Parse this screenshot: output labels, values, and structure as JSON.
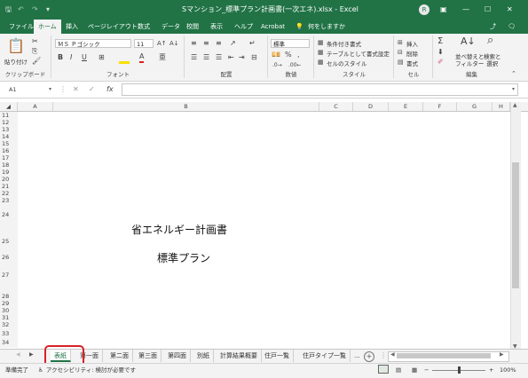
{
  "window": {
    "title": "Sマンション_標準プラン計画書(一次エネ).xlsx - Excel",
    "user_initials": "R",
    "controls": [
      "ribbon-display",
      "minimize",
      "maximize",
      "close"
    ]
  },
  "quick_access": [
    "save",
    "undo",
    "redo",
    "customize"
  ],
  "menu": {
    "tabs": [
      "ファイル",
      "ホーム",
      "挿入",
      "ページレイアウト",
      "数式",
      "データ",
      "校閲",
      "表示",
      "ヘルプ",
      "Acrobat"
    ],
    "active_tab": "ホーム",
    "tell_me": "何をしますか"
  },
  "ribbon": {
    "clipboard": {
      "paste": "貼り付け",
      "label": "クリップボード"
    },
    "font": {
      "name": "ＭＳ Ｐゴシック",
      "size": "11",
      "label": "フォント"
    },
    "alignment": {
      "label": "配置"
    },
    "number": {
      "format": "標準",
      "label": "数値"
    },
    "styles": {
      "items": [
        "条件付き書式",
        "テーブルとして書式設定",
        "セルのスタイル"
      ],
      "label": "スタイル"
    },
    "cells": {
      "items": [
        "挿入",
        "削除",
        "書式"
      ],
      "label": "セル"
    },
    "editing": {
      "sort": "並べ替えと\nフィルター",
      "find": "検索と\n選択",
      "label": "編集"
    }
  },
  "formula_bar": {
    "name_box": "A1",
    "fx": "fx",
    "value": ""
  },
  "columns": [
    "A",
    "B",
    "C",
    "D",
    "E",
    "F",
    "G",
    "H"
  ],
  "rows": [
    "11",
    "12",
    "13",
    "14",
    "15",
    "16",
    "17",
    "18",
    "19",
    "20",
    "21",
    "22",
    "23",
    "24",
    "25",
    "26",
    "27",
    "28",
    "29",
    "30",
    "31",
    "32",
    "33",
    "34"
  ],
  "cells": {
    "b24": "省エネルギー計画書",
    "b25": "標準プラン"
  },
  "sheets": {
    "tabs": [
      "表紙",
      "第一面",
      "第二面",
      "第三面",
      "第四面",
      "別紙",
      "計算結果概要",
      "住戸一覧",
      "住戸タイプ一覧",
      "..."
    ],
    "active": "表紙"
  },
  "status": {
    "ready": "準備完了",
    "accessibility": "アクセシビリティ: 検討が必要です",
    "zoom": "100%"
  }
}
